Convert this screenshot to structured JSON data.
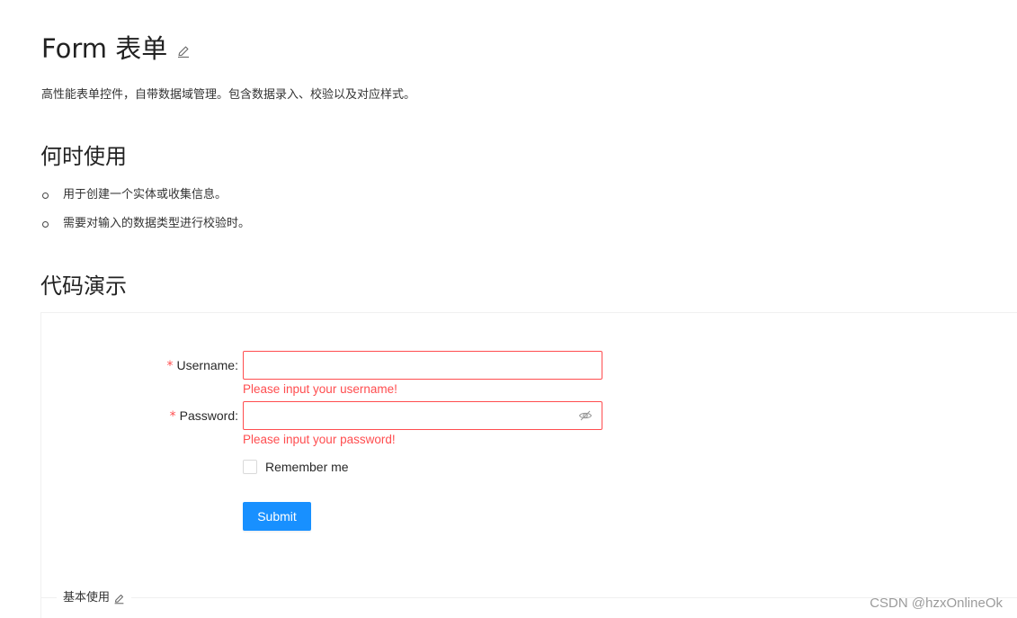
{
  "page": {
    "title": "Form 表单",
    "description": "高性能表单控件，自带数据域管理。包含数据录入、校验以及对应样式。"
  },
  "when_to_use": {
    "heading": "何时使用",
    "items": [
      "用于创建一个实体或收集信息。",
      "需要对输入的数据类型进行校验时。"
    ]
  },
  "demo": {
    "heading": "代码演示",
    "meta_title": "基本使用",
    "form": {
      "required_mark": "*",
      "username": {
        "label": "Username",
        "value": "",
        "error": "Please input your username!"
      },
      "password": {
        "label": "Password",
        "value": "",
        "error": "Please input your password!"
      },
      "label_suffix": ":",
      "remember": {
        "label": "Remember me",
        "checked": false
      },
      "submit_label": "Submit"
    }
  },
  "watermark": "CSDN @hzxOnlineOk",
  "colors": {
    "primary": "#1890ff",
    "error": "#ff4d4f",
    "border": "#d9d9d9"
  },
  "icons": {
    "title_edit": "edit-icon",
    "password_visibility": "eye-invisible-icon",
    "meta_edit": "edit-icon"
  }
}
